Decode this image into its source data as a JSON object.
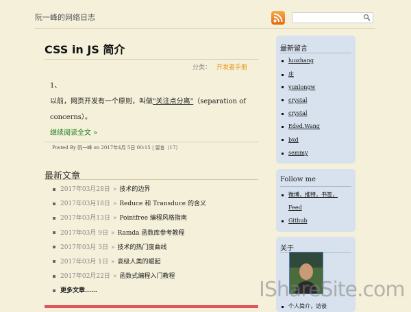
{
  "header": {
    "site_title": "阮一峰的网络日志",
    "search_placeholder": "",
    "icons": {
      "feed": "rss-icon",
      "search": "search-icon"
    }
  },
  "post": {
    "title": "CSS in JS 简介",
    "category_label": "分类：",
    "category": "开发者手册",
    "section_number": "1、",
    "body_before": "以前，网页开发有一个原则，叫做",
    "body_link": "\"关注点分离\"",
    "body_after": "（separation of concerns）。",
    "read_more": "继续阅读全文 »",
    "meta": "Posted By 阮一峰 on 2017年4月 5日 00:15 | 留言（17）"
  },
  "recent": {
    "heading": "最新文章",
    "items": [
      {
        "date": "2017年03月28日",
        "title": "技术的边界"
      },
      {
        "date": "2017年03月18日",
        "title": "Reduce 和 Transduce 的含义"
      },
      {
        "date": "2017年03月13日",
        "title": "Pointfree 编程风格指南"
      },
      {
        "date": "2017年03月 9日",
        "title": "Ramda 函数库参考教程"
      },
      {
        "date": "2017年03月 3日",
        "title": "技术的热门度曲线"
      },
      {
        "date": "2017年03月 1日",
        "title": "高级人类的崛起"
      },
      {
        "date": "2017年02月22日",
        "title": "函数式编程入门教程"
      }
    ],
    "more": "更多文章……"
  },
  "sidebar": {
    "comments": {
      "title": "最新留言",
      "items": [
        "luozhang",
        "庄",
        "yunlongw",
        "crystal",
        "crystal",
        "Eded.Wang",
        "bxd",
        "semmy"
      ]
    },
    "follow": {
      "title": "Follow me",
      "line1": [
        "微博",
        "推特",
        "书签"
      ],
      "line2": "Feed",
      "line3": "Github"
    },
    "about": {
      "title": "关于",
      "item": "个人简介，访谈"
    }
  },
  "watermark": "IShareSite.com",
  "colors": {
    "background": "#f4f0da",
    "sidebar_box": "#d7e2ee",
    "category_link": "#e8950f",
    "read_more": "#1a7a1a",
    "accent_bar": "#e0565a"
  }
}
